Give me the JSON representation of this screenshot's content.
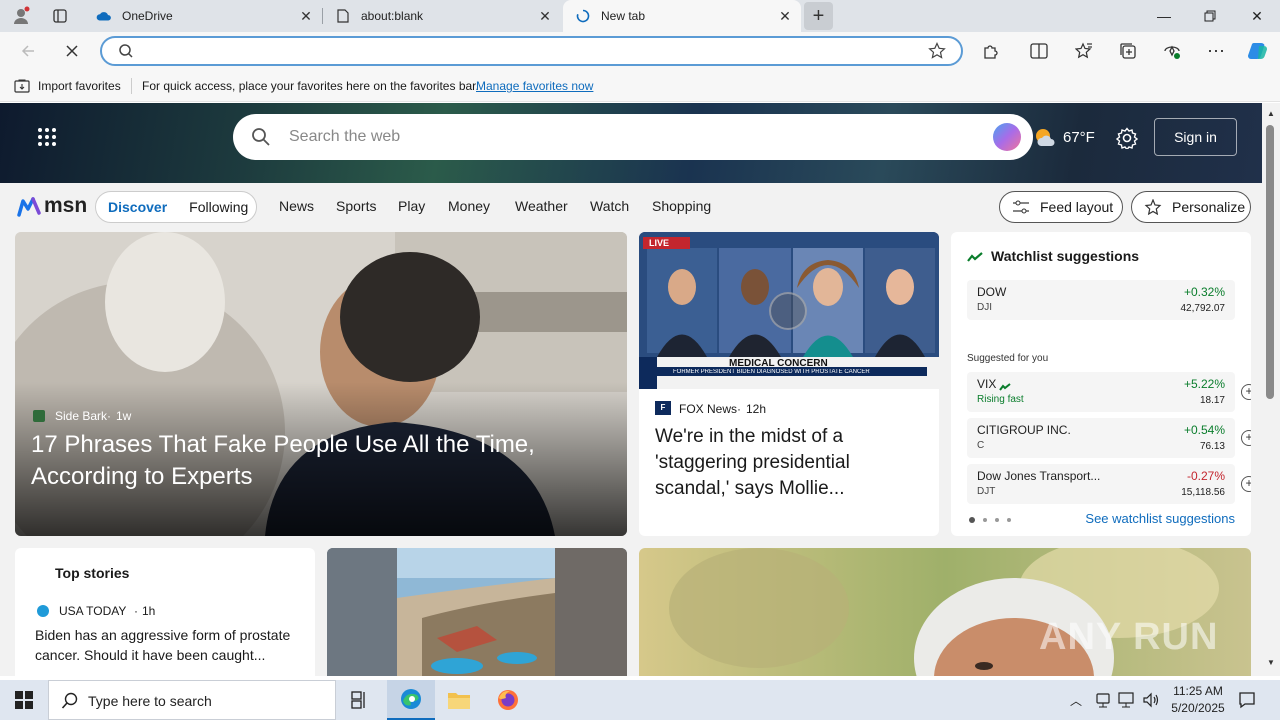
{
  "tabs": [
    {
      "label": "OneDrive"
    },
    {
      "label": "about:blank"
    },
    {
      "label": "New tab"
    }
  ],
  "address": {
    "value": "",
    "placeholder": ""
  },
  "favorites_bar": {
    "import_label": "Import favorites",
    "hint": "For quick access, place your favorites here on the favorites bar.",
    "manage_link": "Manage favorites now"
  },
  "msn": {
    "search_placeholder": "Search the web",
    "weather": "67°F",
    "signin": "Sign in",
    "logo_text": "msn",
    "tabs": {
      "discover": "Discover",
      "following": "Following"
    },
    "nav": [
      "News",
      "Sports",
      "Play",
      "Money",
      "Weather",
      "Watch",
      "Shopping"
    ],
    "feed_layout": "Feed layout",
    "personalize": "Personalize"
  },
  "hero": {
    "source": "Side Bark",
    "age": "1w",
    "headline": "17 Phrases That Fake People Use All the Time, According to Experts"
  },
  "fox_card": {
    "live": "LIVE",
    "banner": "MEDICAL CONCERN",
    "ticker": "FORMER PRESIDENT BIDEN DIAGNOSED WITH PROSTATE CANCER",
    "source": "FOX News",
    "age": "12h",
    "headline": "We're in the midst of a 'staggering presidential scandal,' says Mollie..."
  },
  "watchlist": {
    "title": "Watchlist suggestions",
    "suggested_label": "Suggested for you",
    "see_link": "See watchlist suggestions",
    "rows": [
      {
        "name": "DOW",
        "sub": "DJI",
        "pct": "+0.32%",
        "price": "42,792.07",
        "dir": "up"
      },
      {
        "name": "VIX",
        "sub": "Rising fast",
        "pct": "+5.22%",
        "price": "18.17",
        "dir": "up"
      },
      {
        "name": "CITIGROUP INC.",
        "sub": "C",
        "pct": "+0.54%",
        "price": "76.13",
        "dir": "up"
      },
      {
        "name": "Dow Jones Transport...",
        "sub": "DJT",
        "pct": "-0.27%",
        "price": "15,118.56",
        "dir": "down"
      }
    ]
  },
  "top_stories": {
    "title": "Top stories",
    "source": "USA TODAY",
    "age": "1h",
    "headline": "Biden has an aggressive form of prostate cancer. Should it have been caught..."
  },
  "taskbar": {
    "search_placeholder": "Type here to search",
    "time": "11:25 AM",
    "date": "5/20/2025"
  },
  "watermark": "ANY RUN",
  "colors": {
    "accent": "#0f6cbd",
    "green": "#0a7d2c",
    "red": "#c4262e",
    "link": "#0f6cbd"
  }
}
